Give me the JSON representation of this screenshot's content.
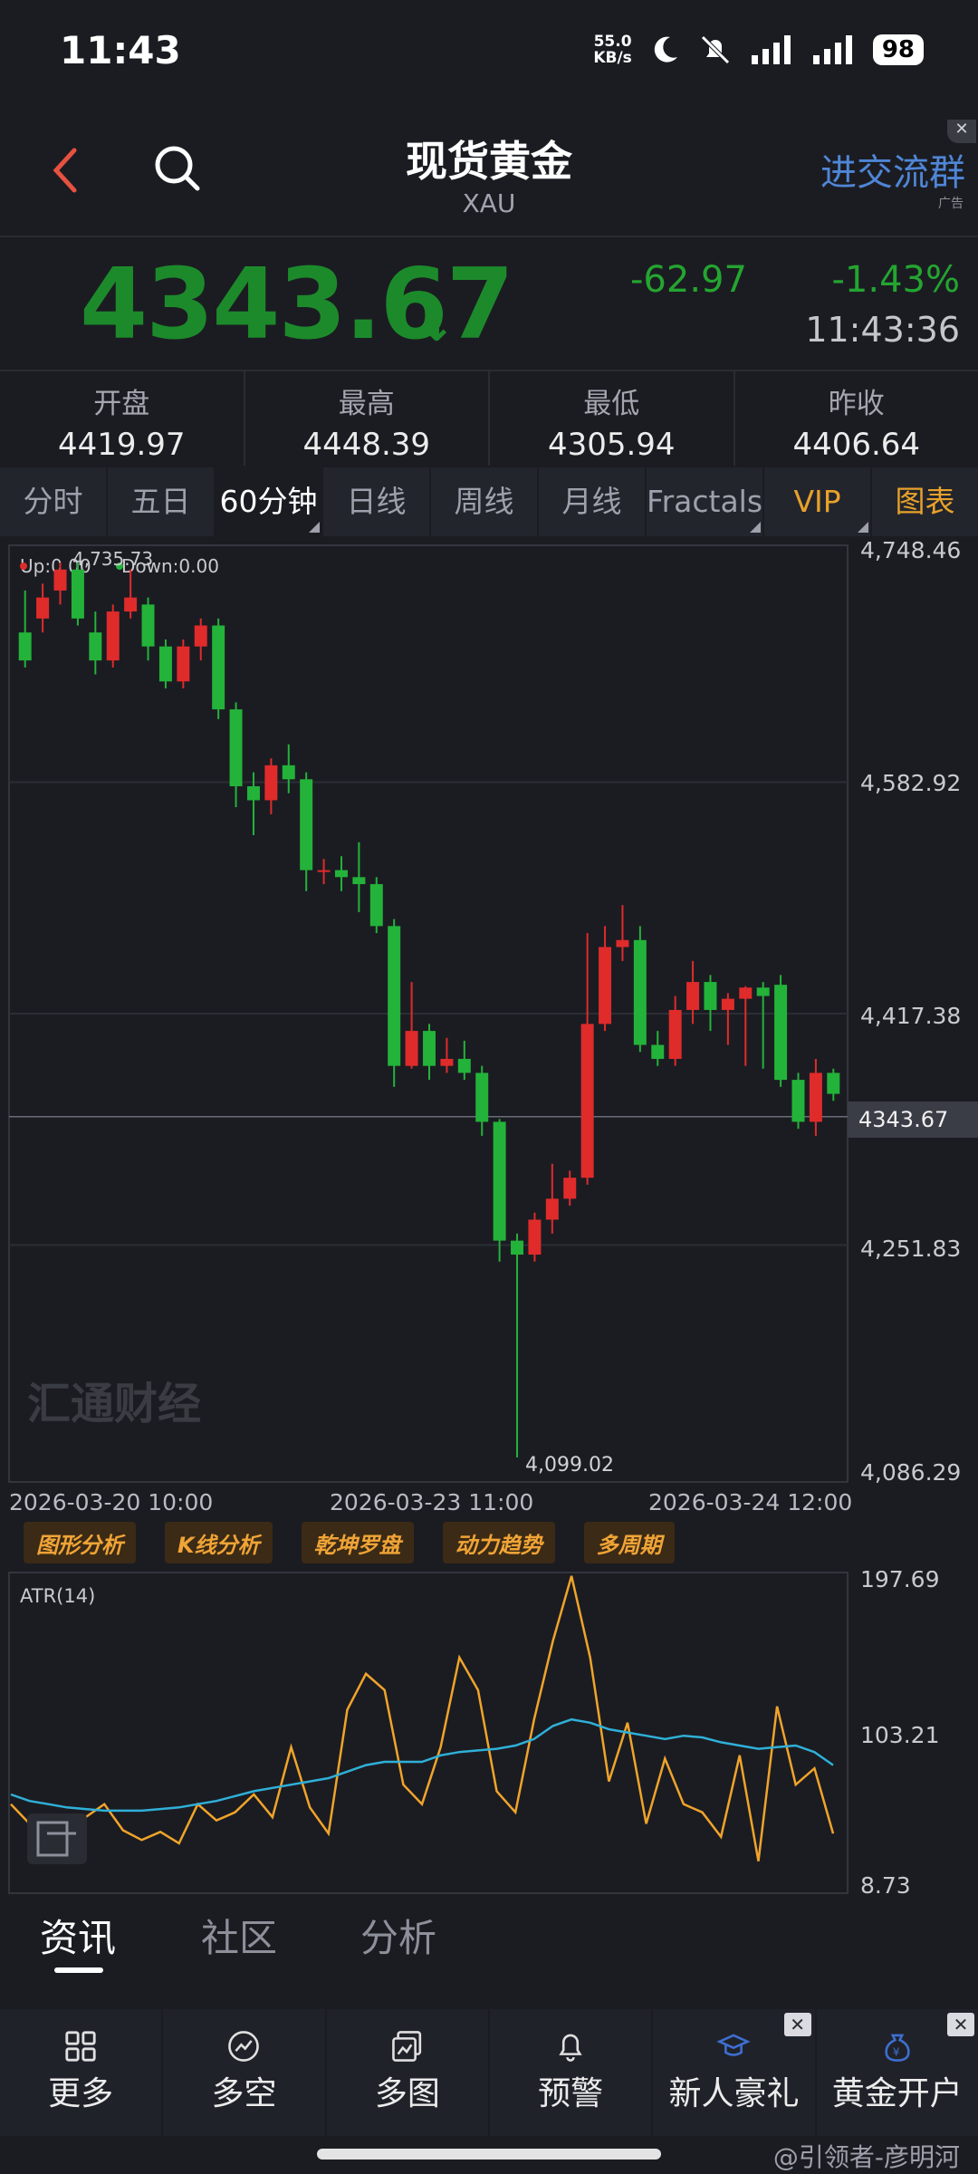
{
  "status_bar": {
    "time": "11:43",
    "net_speed_value": "55.0",
    "net_speed_unit": "KB/s",
    "battery": "98"
  },
  "header": {
    "title": "现货黄金",
    "subtitle": "XAU",
    "ad_text": "进交流群",
    "ad_tag": "广告"
  },
  "quote": {
    "last": "4343.67",
    "change": "-62.97",
    "change_pct": "-1.43%",
    "time": "11:43:36",
    "color_down": "#1c8a2b"
  },
  "stats": [
    {
      "label": "开盘",
      "value": "4419.97"
    },
    {
      "label": "最高",
      "value": "4448.39"
    },
    {
      "label": "最低",
      "value": "4305.94"
    },
    {
      "label": "昨收",
      "value": "4406.64"
    }
  ],
  "periods": [
    "分时",
    "五日",
    "60分钟",
    "日线",
    "周线",
    "月线",
    "Fractals",
    "VIP",
    "图表"
  ],
  "main_chart": {
    "legend_up": "Up:0.00",
    "legend_down": "Down:0.00",
    "watermark": "汇通财经",
    "y_ticks": [
      "4,748.46",
      "4,582.92",
      "4,417.38",
      "4,251.83",
      "4,086.29"
    ],
    "current_price_label": "4343.67",
    "high_marker": "4,735.73",
    "low_marker": "4,099.02",
    "dates": [
      "2026-03-20 10:00",
      "2026-03-23 11:00",
      "2026-03-24 12:00"
    ]
  },
  "tools": [
    "图形分析",
    "K线分析",
    "乾坤罗盘",
    "动力趋势",
    "多周期"
  ],
  "atr_chart": {
    "label": "ATR(14)",
    "y_ticks": [
      "197.69",
      "103.21",
      "8.73"
    ]
  },
  "chart_data": {
    "type": "candlestick",
    "interval": "60分钟",
    "ylim": [
      4086.29,
      4748.46
    ],
    "candles": [
      [
        4690,
        4720,
        4670,
        4665
      ],
      [
        4700,
        4725,
        4715,
        4690
      ],
      [
        4720,
        4740,
        4735,
        4710
      ],
      [
        4735,
        4740,
        4700,
        4695
      ],
      [
        4690,
        4705,
        4670,
        4660
      ],
      [
        4670,
        4710,
        4705,
        4665
      ],
      [
        4705,
        4735,
        4715,
        4700
      ],
      [
        4710,
        4715,
        4680,
        4670
      ],
      [
        4680,
        4685,
        4655,
        4650
      ],
      [
        4655,
        4685,
        4680,
        4650
      ],
      [
        4680,
        4700,
        4695,
        4670
      ],
      [
        4695,
        4700,
        4635,
        4628
      ],
      [
        4635,
        4640,
        4580,
        4565
      ],
      [
        4580,
        4590,
        4570,
        4545
      ],
      [
        4570,
        4600,
        4595,
        4560
      ],
      [
        4595,
        4610,
        4585,
        4575
      ],
      [
        4585,
        4590,
        4520,
        4505
      ],
      [
        4520,
        4528,
        4520,
        4510
      ],
      [
        4520,
        4530,
        4515,
        4505
      ],
      [
        4515,
        4540,
        4510,
        4490
      ],
      [
        4510,
        4515,
        4480,
        4475
      ],
      [
        4480,
        4485,
        4380,
        4365
      ],
      [
        4380,
        4440,
        4405,
        4378
      ],
      [
        4405,
        4410,
        4380,
        4370
      ],
      [
        4380,
        4400,
        4385,
        4375
      ],
      [
        4385,
        4398,
        4375,
        4370
      ],
      [
        4375,
        4380,
        4340,
        4330
      ],
      [
        4340,
        4342,
        4255,
        4240
      ],
      [
        4255,
        4260,
        4245,
        4100
      ],
      [
        4245,
        4275,
        4270,
        4240
      ],
      [
        4270,
        4310,
        4285,
        4260
      ],
      [
        4285,
        4305,
        4300,
        4280
      ],
      [
        4300,
        4475,
        4410,
        4295
      ],
      [
        4410,
        4480,
        4465,
        4405
      ],
      [
        4465,
        4495,
        4470,
        4455
      ],
      [
        4470,
        4480,
        4395,
        4390
      ],
      [
        4395,
        4405,
        4385,
        4380
      ],
      [
        4385,
        4430,
        4420,
        4380
      ],
      [
        4420,
        4455,
        4440,
        4410
      ],
      [
        4440,
        4445,
        4420,
        4405
      ],
      [
        4420,
        4432,
        4428,
        4395
      ],
      [
        4428,
        4437,
        4436,
        4380
      ],
      [
        4436,
        4440,
        4430,
        4378
      ],
      [
        4438,
        4445,
        4370,
        4365
      ],
      [
        4370,
        4375,
        4340,
        4335
      ],
      [
        4340,
        4385,
        4375,
        4330
      ],
      [
        4375,
        4378,
        4360,
        4355
      ]
    ],
    "atr_values": [
      60,
      48,
      30,
      52,
      52,
      60,
      44,
      38,
      43,
      36,
      60,
      50,
      55,
      66,
      52,
      95,
      58,
      42,
      118,
      140,
      130,
      72,
      60,
      95,
      150,
      130,
      68,
      55,
      112,
      160,
      200,
      150,
      74,
      110,
      48,
      88,
      60,
      55,
      40,
      90,
      25,
      120,
      72,
      82,
      42
    ],
    "atr_avg": [
      66,
      62,
      60,
      58,
      57,
      56,
      56,
      56,
      57,
      58,
      60,
      62,
      65,
      68,
      70,
      72,
      74,
      76,
      80,
      84,
      86,
      86,
      86,
      90,
      92,
      93,
      94,
      96,
      100,
      108,
      112,
      110,
      106,
      104,
      102,
      100,
      102,
      101,
      98,
      96,
      94,
      95,
      96,
      92,
      84
    ]
  },
  "news_tabs": [
    "资讯",
    "社区",
    "分析"
  ],
  "bottom_nav": [
    {
      "label": "更多",
      "icon": "grid-icon"
    },
    {
      "label": "多空",
      "icon": "trend-icon"
    },
    {
      "label": "多图",
      "icon": "multi-chart-icon"
    },
    {
      "label": "预警",
      "icon": "bell-icon"
    },
    {
      "label": "新人豪礼",
      "icon": "graduation-icon"
    },
    {
      "label": "黄金开户",
      "icon": "money-bag-icon"
    }
  ],
  "watermark_bottom": "@引领者-彦明河"
}
